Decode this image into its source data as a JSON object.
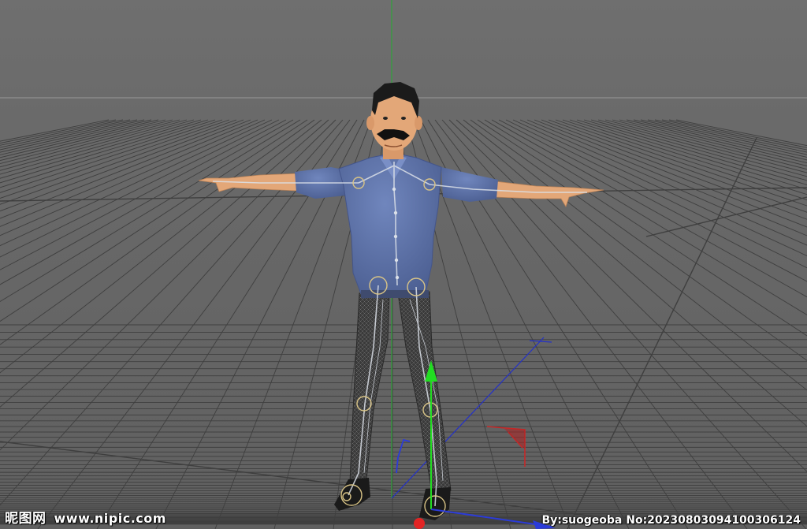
{
  "viewport": {
    "background_color": "#6b6b6b",
    "grid_color": "#3f3f3f",
    "horizon_color": "#8a8a8a",
    "y_axis_color": "#2fa33a"
  },
  "character": {
    "shirt_color": "#5f74a8",
    "skin_color": "#e3a778",
    "pants_color": "#3a3a3a",
    "hair_color": "#1b1b1b",
    "bone_color": "#dbe0e8",
    "joint_color": "#d9c486"
  },
  "gizmo": {
    "y_axis_color": "#22dd22",
    "x_axis_color": "#e32424",
    "z_axis_color": "#2b3bd8"
  },
  "watermark": {
    "site_name": "昵图网",
    "site_url": "www.nipic.com",
    "credit": "By:suogeoba No:20230803094100306124"
  }
}
